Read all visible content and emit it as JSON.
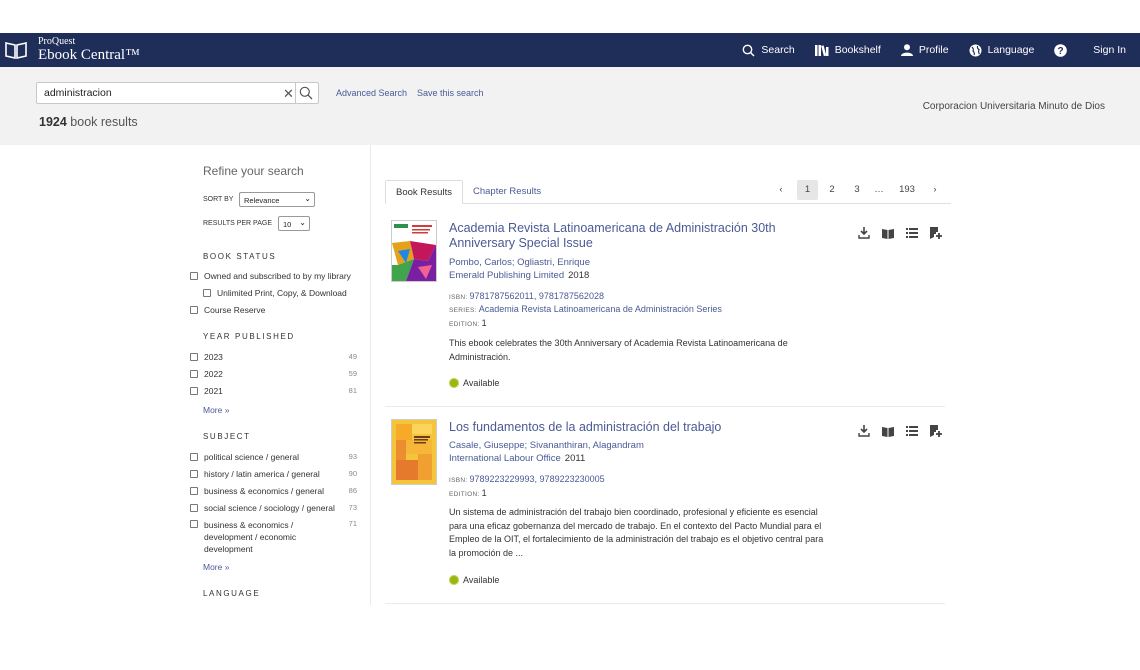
{
  "header": {
    "brand_small": "ProQuest",
    "brand_big": "Ebook Central™",
    "nav": [
      {
        "label": "Search",
        "icon": "search-icon"
      },
      {
        "label": "Bookshelf",
        "icon": "bookshelf-icon"
      },
      {
        "label": "Profile",
        "icon": "user-icon"
      },
      {
        "label": "Language",
        "icon": "globe-icon"
      },
      {
        "label": "",
        "icon": "help-icon"
      },
      {
        "label": "Sign In",
        "icon": ""
      }
    ],
    "bg_color": "#1f2d59"
  },
  "search": {
    "value": "administracion",
    "advanced_label": "Advanced Search",
    "save_label": "Save this search",
    "count": "1924",
    "count_suffix": " book results",
    "institution": "Corporacion Universitaria Minuto de Dios"
  },
  "sidebar": {
    "title": "Refine your search",
    "sort_label": "SORT BY",
    "sort_value": "Relevance",
    "rpp_label": "RESULTS PER PAGE",
    "rpp_value": "10",
    "book_status": {
      "title": "BOOK STATUS",
      "items": [
        {
          "label": "Owned and subscribed to by my library"
        },
        {
          "label": "Unlimited Print, Copy, & Download"
        },
        {
          "label": "Course Reserve"
        }
      ]
    },
    "year": {
      "title": "YEAR PUBLISHED",
      "items": [
        {
          "label": "2023",
          "count": "49"
        },
        {
          "label": "2022",
          "count": "59"
        },
        {
          "label": "2021",
          "count": "81"
        }
      ],
      "more": "More"
    },
    "subject": {
      "title": "SUBJECT",
      "items": [
        {
          "label": "political science / general",
          "count": "93"
        },
        {
          "label": "history / latin america / general",
          "count": "90"
        },
        {
          "label": "business & economics / general",
          "count": "86"
        },
        {
          "label": "social science / sociology / general",
          "count": "73"
        },
        {
          "label": "business & economics / development / economic development",
          "count": "71"
        }
      ],
      "more": "More"
    },
    "language_title": "LANGUAGE"
  },
  "tabs": {
    "book": "Book Results",
    "chapter": "Chapter Results"
  },
  "pager": {
    "pages": [
      "1",
      "2",
      "3",
      "…",
      "193"
    ],
    "current": "1"
  },
  "results": [
    {
      "title": "Academia Revista Latinoamericana de Administración 30th Anniversary Special Issue",
      "authors": "Pombo, Carlos; Ogliastri, Enrique",
      "publisher": "Emerald Publishing Limited",
      "year": "2018",
      "isbn_label": "ISBN:",
      "isbn": "9781787562011, 9781787562028",
      "series_label": "SERIES:",
      "series": "Academia Revista Latinoamericana de Administración Series",
      "edition_label": "EDITION:",
      "edition": "1",
      "description": "This ebook celebrates the 30th Anniversary of Academia Revista Latinoamericana de Administración.",
      "status": "Available"
    },
    {
      "title": "Los fundamentos de la administración del trabajo",
      "authors": "Casale, Giuseppe; Sivananthiran, Alagandram",
      "publisher": "International Labour Office",
      "year": "2011",
      "isbn_label": "ISBN:",
      "isbn": "9789223229993, 9789223230005",
      "edition_label": "EDITION:",
      "edition": "1",
      "description": "Un sistema de administración del trabajo bien coordinado, profesional y eficiente es esencial para una eficaz gobernanza del mercado de trabajo. En el contexto del Pacto Mundial para el Empleo de la OIT, el fortalecimiento de la administración del trabajo es el objetivo central para la promoción de ...",
      "status": "Available"
    }
  ],
  "colors": {
    "link": "#4b5a95",
    "available": "#9ab70f"
  }
}
